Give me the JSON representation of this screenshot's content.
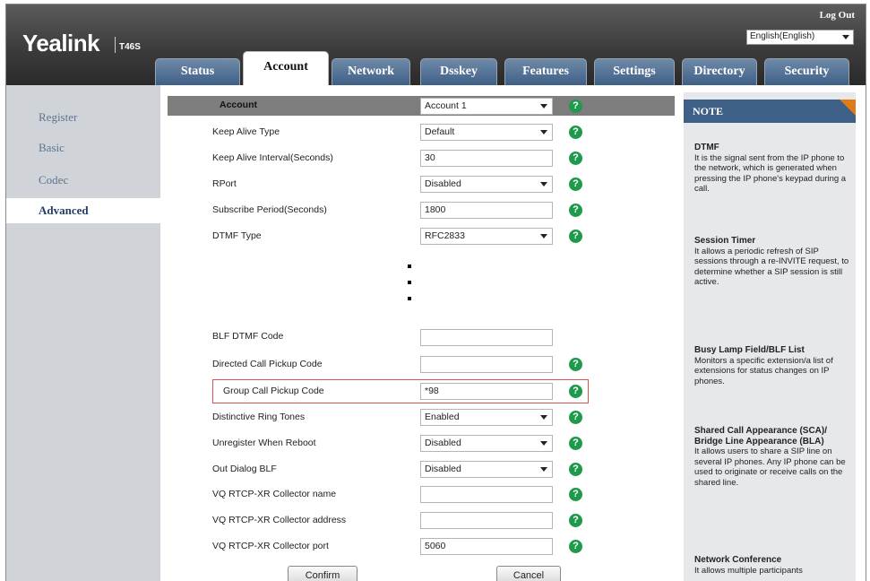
{
  "header": {
    "logo": "Yealink",
    "model": "T46S",
    "logout": "Log Out",
    "language": "English(English)"
  },
  "tabs": [
    "Status",
    "Account",
    "Network",
    "Dsskey",
    "Features",
    "Settings",
    "Directory",
    "Security"
  ],
  "active_tab": "Account",
  "sidebar": {
    "items": [
      "Register",
      "Basic",
      "Codec",
      "Advanced"
    ],
    "active": "Advanced"
  },
  "form": {
    "header_label": "Account",
    "header_value": "Account 1",
    "rows_top": [
      {
        "label": "Keep Alive Type",
        "value": "Default",
        "type": "select"
      },
      {
        "label": "Keep Alive Interval(Seconds)",
        "value": "30",
        "type": "text"
      },
      {
        "label": "RPort",
        "value": "Disabled",
        "type": "select"
      },
      {
        "label": "Subscribe Period(Seconds)",
        "value": "1800",
        "type": "text"
      },
      {
        "label": "DTMF Type",
        "value": "RFC2833",
        "type": "select"
      }
    ],
    "rows_bottom": [
      {
        "label": "BLF DTMF Code",
        "value": "",
        "type": "text"
      },
      {
        "label": "Directed Call Pickup Code",
        "value": "",
        "type": "text"
      },
      {
        "label": "Group Call Pickup Code",
        "value": "*98",
        "type": "text"
      },
      {
        "label": "Distinctive Ring Tones",
        "value": "Enabled",
        "type": "select"
      },
      {
        "label": "Unregister When Reboot",
        "value": "Disabled",
        "type": "select"
      },
      {
        "label": "Out Dialog BLF",
        "value": "Disabled",
        "type": "select"
      },
      {
        "label": "VQ RTCP-XR Collector name",
        "value": "",
        "type": "text"
      },
      {
        "label": "VQ RTCP-XR Collector address",
        "value": "",
        "type": "text"
      },
      {
        "label": "VQ RTCP-XR Collector port",
        "value": "5060",
        "type": "text"
      }
    ],
    "help_glyph": "?",
    "confirm": "Confirm",
    "cancel": "Cancel"
  },
  "note": {
    "title": "NOTE",
    "sections": [
      {
        "title": "DTMF",
        "text": "It is the signal sent from the IP phone to the network, which is generated when pressing the IP phone's keypad during a call."
      },
      {
        "title": "Session Timer",
        "text": "It allows a periodic refresh of SIP sessions through a re-INVITE request, to determine whether a SIP session is still active."
      },
      {
        "title": "Busy Lamp Field/BLF List",
        "text": "Monitors a specific extension/a list of extensions for status changes on IP phones."
      },
      {
        "title": "Shared Call Appearance (SCA)/ Bridge Line Appearance (BLA)",
        "text": "It allows users to share a SIP line on several IP phones. Any IP phone can be used to originate or receive calls on the shared line."
      },
      {
        "title": "Network Conference",
        "text": "It allows multiple participants"
      }
    ]
  },
  "colors": {
    "tab_blue": "#3e5f86",
    "help_green": "#1f9a4c",
    "highlight_red": "#d9534f",
    "note_corner": "#e07b1c"
  }
}
